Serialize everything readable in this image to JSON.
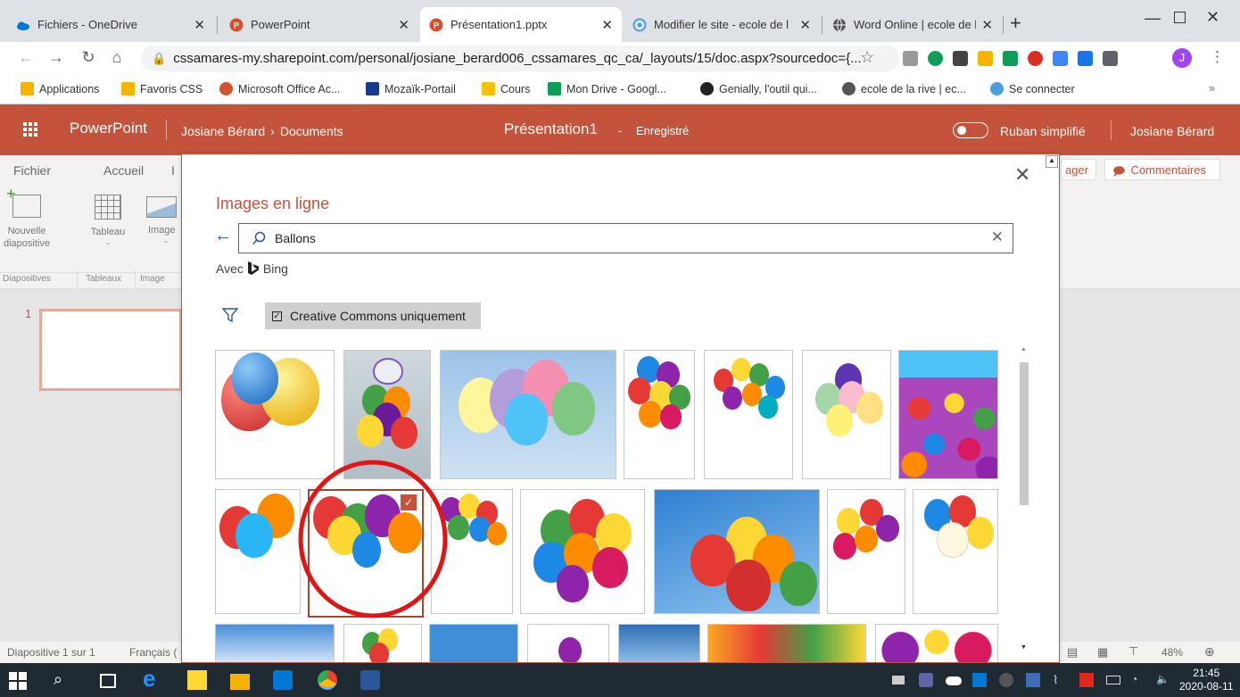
{
  "browser": {
    "tabs": [
      {
        "title": "Fichiers - OneDrive",
        "icon": "onedrive-icon",
        "color": "#0078d4"
      },
      {
        "title": "PowerPoint",
        "icon": "powerpoint-icon",
        "color": "#d35230"
      },
      {
        "title": "Présentation1.pptx",
        "icon": "powerpoint-icon",
        "color": "#d35230"
      },
      {
        "title": "Modifier le site - ecole de l",
        "icon": "sites-icon",
        "color": "#4a9fd8"
      },
      {
        "title": "Word Online | ecole de la ri",
        "icon": "globe-icon",
        "color": "#555555"
      }
    ],
    "url": "cssamares-my.sharepoint.com/personal/josiane_berard006_cssamares_qc_ca/_layouts/15/doc.aspx?sourcedoc={...",
    "profile_initial": "J",
    "bookmarks": [
      {
        "label": "Applications",
        "color": "#f4b400"
      },
      {
        "label": "Favoris CSS",
        "color": "#f4b400"
      },
      {
        "label": "Microsoft Office Ac...",
        "color": "#d35230"
      },
      {
        "label": "Mozaïk-Portail",
        "color": "#1a3a8c"
      },
      {
        "label": "Cours",
        "color": "#f4c20d"
      },
      {
        "label": "Mon Drive - Googl...",
        "color": "#0f9d58"
      },
      {
        "label": "Genially, l'outil qui...",
        "color": "#222222"
      },
      {
        "label": "ecole de la rive | ec...",
        "color": "#555555"
      },
      {
        "label": "Se connecter",
        "color": "#4a9fd8"
      }
    ],
    "bookmarks_more": "»"
  },
  "ppt": {
    "app_name": "PowerPoint",
    "breadcrumb_user": "Josiane Bérard",
    "breadcrumb_folder": "Documents",
    "doc_title": "Présentation1",
    "save_status": "Enregistré",
    "simplified_ribbon": "Ruban simplifié",
    "user_name": "Josiane Bérard",
    "menu_tabs": [
      "Fichier",
      "Accueil",
      "I"
    ],
    "share_label": "ager",
    "comments_label": "Commentaires",
    "ribbon_buttons": [
      {
        "label": "Nouvelle diapositive"
      },
      {
        "label": "Tableau"
      },
      {
        "label": "Image"
      }
    ],
    "ribbon_groups": [
      "Diapositives",
      "Tableaux",
      "Image"
    ],
    "slide_number": "1",
    "status_slide": "Diapositive 1 sur 1",
    "status_lang": "Français (",
    "zoom": "48%",
    "accent": "#c4533b"
  },
  "dialog": {
    "title": "Images en ligne",
    "search_value": "Ballons",
    "provider_prefix": "Avec",
    "provider": "Bing",
    "filter_label": "Creative Commons uniquement"
  },
  "taskbar": {
    "time": "21:45",
    "date": "2020-08-11"
  }
}
